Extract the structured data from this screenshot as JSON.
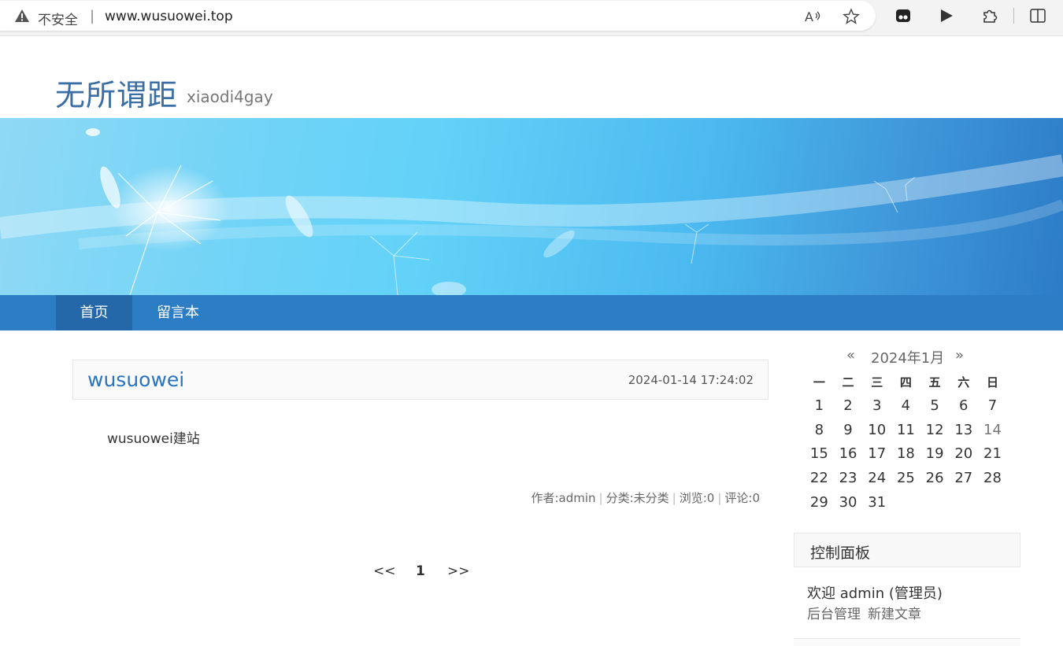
{
  "browser": {
    "security_label": "不安全",
    "separator": "|",
    "url": "www.wusuowei.top"
  },
  "site": {
    "title": "无所谓距",
    "subtitle": "xiaodi4gay"
  },
  "nav": {
    "items": [
      {
        "label": "首页",
        "active": true
      },
      {
        "label": "留言本",
        "active": false
      }
    ]
  },
  "post": {
    "title": "wusuowei",
    "date": "2024-01-14 17:24:02",
    "body": "wusuowei建站",
    "meta": {
      "author": "作者:admin",
      "category": "分类:未分类",
      "views": "浏览:0",
      "comments": "评论:0"
    }
  },
  "pager": {
    "prev": "<<",
    "current": "1",
    "next": ">>"
  },
  "calendar": {
    "prev": "«",
    "month": "2024年1月",
    "next": "»",
    "weekdays": [
      "一",
      "二",
      "三",
      "四",
      "五",
      "六",
      "日"
    ],
    "weeks": [
      [
        "1",
        "2",
        "3",
        "4",
        "5",
        "6",
        "7"
      ],
      [
        "8",
        "9",
        "10",
        "11",
        "12",
        "13",
        "14"
      ],
      [
        "15",
        "16",
        "17",
        "18",
        "19",
        "20",
        "21"
      ],
      [
        "22",
        "23",
        "24",
        "25",
        "26",
        "27",
        "28"
      ],
      [
        "29",
        "30",
        "31",
        "",
        "",
        "",
        ""
      ]
    ],
    "today": "14"
  },
  "panel": {
    "title": "控制面板",
    "welcome": "欢迎 admin (管理员)",
    "links": [
      "后台管理",
      "新建文章"
    ]
  },
  "colors": {
    "nav_bg": "#2d7dc5",
    "nav_active": "#2468aa",
    "title_blue": "#3b6ea5",
    "link_blue": "#2a74bd"
  }
}
